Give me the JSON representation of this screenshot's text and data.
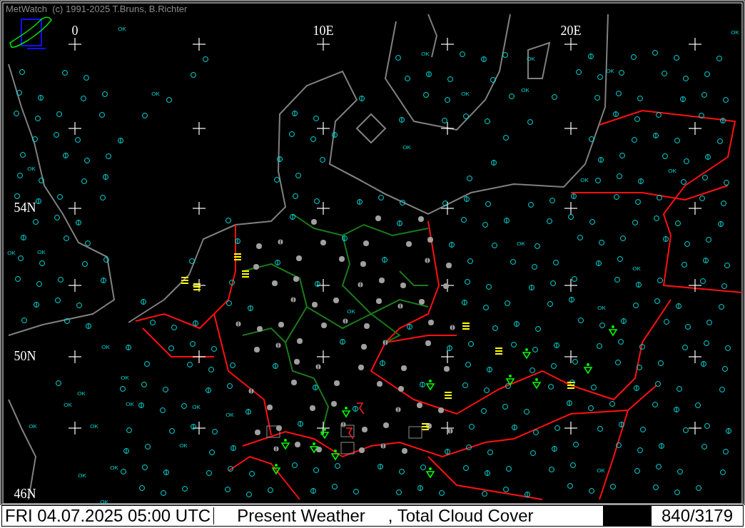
{
  "app_title": "MetWatch  (c) 1991-2025 T.Bruns, B.Richter",
  "longitude_labels": [
    "0",
    "10E",
    "20E"
  ],
  "latitude_labels": [
    "54N",
    "50N",
    "46N"
  ],
  "station_labels": [
    "OK",
    "OK",
    "OK",
    "OK",
    "OK",
    "OK",
    "OK",
    "OK",
    "OK",
    "OK",
    "OK",
    "OK",
    "OK",
    "OK",
    "OK",
    "OK",
    "OK",
    "OK",
    "OK",
    "OK",
    "OK",
    "OK",
    "OK",
    "OK",
    "OK",
    "OK",
    "OK",
    "OK",
    "OK",
    "OK",
    "OK",
    "OK"
  ],
  "status_bar": {
    "time": "FRI 04.07.2025 05:00 UTC",
    "parameter": "Present Weather",
    "overlay": ", Total Cloud Cover",
    "count": "840/3179"
  }
}
